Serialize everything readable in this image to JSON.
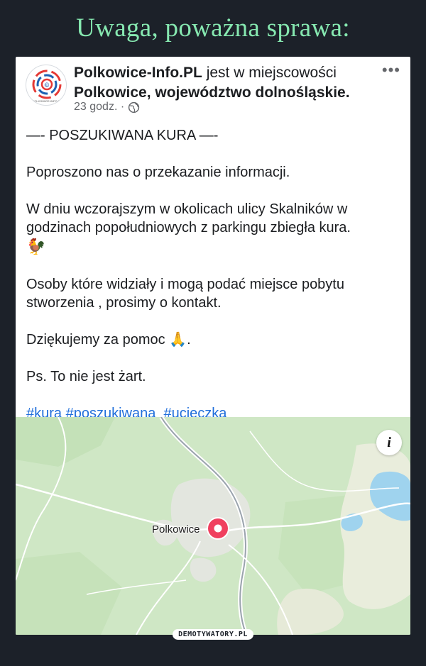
{
  "page_title": "Uwaga, poważna sprawa:",
  "post": {
    "author": "Polkowice-Info.PL",
    "action_text": " jest w miejscowości",
    "location": "Polkowice, województwo dolnośląskie.",
    "time": "23 godz. ·",
    "more_label": "•••",
    "avatar_caption": "POLKOWICE-INFO.PL",
    "lines": [
      "—- POSZUKIWANA KURA —-",
      "",
      "Poproszono nas o przekazanie informacji.",
      "",
      "W dniu wczorajszym w okolicach ulicy Skalników w",
      "godzinach popołudniowych z parkingu zbiegła kura.",
      "🐓",
      "",
      "Osoby które widziały i mogą podać miejsce pobytu",
      "stworzenia , prosimy o kontakt.",
      "",
      "Dziękujemy za pomoc 🙏.",
      "",
      "Ps. To nie jest żart.",
      ""
    ],
    "hashtags": [
      "#kura",
      "#poszukiwana",
      "#ucieczka"
    ]
  },
  "map": {
    "place": "Polkowice",
    "info_label": "i",
    "pin_color": "#f0405f"
  },
  "watermark": "DEMOTYWATORY.PL",
  "colors": {
    "background": "#1c2129",
    "title": "#86e8b0",
    "link": "#216fdb",
    "map_green": "#cfe7c5",
    "water": "#9fd3ee"
  }
}
